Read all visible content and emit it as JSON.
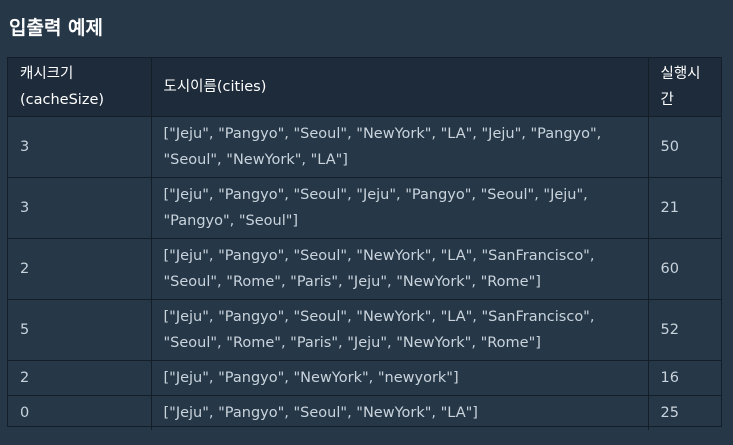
{
  "title": "입출력 예제",
  "table": {
    "headers": [
      "캐시크기 (cacheSize)",
      "도시이름(cities)",
      "실행시간"
    ],
    "rows": [
      {
        "cache": "3",
        "cities": "[\"Jeju\", \"Pangyo\", \"Seoul\", \"NewYork\", \"LA\", \"Jeju\", \"Pangyo\", \"Seoul\", \"NewYork\", \"LA\"]",
        "time": "50"
      },
      {
        "cache": "3",
        "cities": "[\"Jeju\", \"Pangyo\", \"Seoul\", \"Jeju\", \"Pangyo\", \"Seoul\", \"Jeju\", \"Pangyo\", \"Seoul\"]",
        "time": "21"
      },
      {
        "cache": "2",
        "cities": "[\"Jeju\", \"Pangyo\", \"Seoul\", \"NewYork\", \"LA\", \"SanFrancisco\", \"Seoul\", \"Rome\", \"Paris\", \"Jeju\", \"NewYork\", \"Rome\"]",
        "time": "60"
      },
      {
        "cache": "5",
        "cities": "[\"Jeju\", \"Pangyo\", \"Seoul\", \"NewYork\", \"LA\", \"SanFrancisco\", \"Seoul\", \"Rome\", \"Paris\", \"Jeju\", \"NewYork\", \"Rome\"]",
        "time": "52"
      },
      {
        "cache": "2",
        "cities": "[\"Jeju\", \"Pangyo\", \"NewYork\", \"newyork\"]",
        "time": "16"
      },
      {
        "cache": "0",
        "cities": "[\"Jeju\", \"Pangyo\", \"Seoul\", \"NewYork\", \"LA\"]",
        "time": "25"
      }
    ]
  },
  "colors": {
    "background": "#263747",
    "header_background": "#1e2b3a",
    "border": "#141e29",
    "text": "#c9d3dc",
    "header_text": "#ffffff"
  }
}
